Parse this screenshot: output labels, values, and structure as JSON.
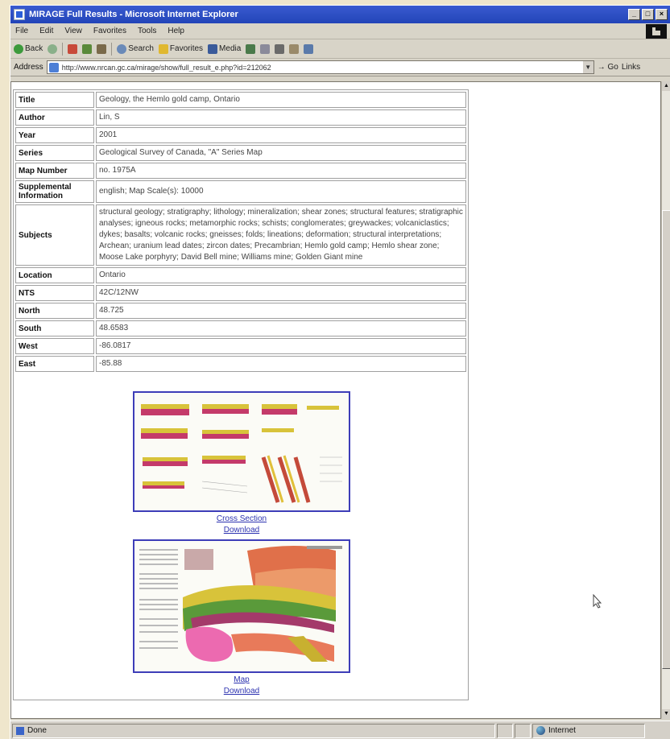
{
  "window": {
    "title": "MIRAGE Full Results - Microsoft Internet Explorer"
  },
  "menu": [
    "File",
    "Edit",
    "View",
    "Favorites",
    "Tools",
    "Help"
  ],
  "toolbar": {
    "back": "Back",
    "search": "Search",
    "favorites": "Favorites",
    "media": "Media"
  },
  "address": {
    "label": "Address",
    "url": "http://www.nrcan.gc.ca/mirage/show/full_result_e.php?id=212062",
    "go": "Go",
    "links": "Links"
  },
  "record": [
    {
      "label": "Title",
      "value": "Geology, the Hemlo gold camp, Ontario"
    },
    {
      "label": "Author",
      "value": "Lin, S"
    },
    {
      "label": "Year",
      "value": "2001"
    },
    {
      "label": "Series",
      "value": "Geological Survey of Canada, \"A\" Series Map"
    },
    {
      "label": "Map Number",
      "value": "no. 1975A"
    },
    {
      "label": "Supplemental Information",
      "value": "english; Map Scale(s): 10000"
    },
    {
      "label": "Subjects",
      "value": "structural geology; stratigraphy; lithology; mineralization; shear zones; structural features; stratigraphic analyses; igneous rocks; metamorphic rocks; schists; conglomerates; greywackes; volcaniclastics; dykes; basalts; volcanic rocks; gneisses; folds; lineations; deformation; structural interpretations; Archean; uranium lead dates; zircon dates; Precambrian; Hemlo gold camp; Hemlo shear zone; Moose Lake porphyry; David Bell mine; Williams mine; Golden Giant mine"
    },
    {
      "label": "Location",
      "value": "Ontario"
    },
    {
      "label": "NTS",
      "value": "42C/12NW"
    },
    {
      "label": "North",
      "value": "48.725"
    },
    {
      "label": "South",
      "value": "48.6583"
    },
    {
      "label": "West",
      "value": "-86.0817"
    },
    {
      "label": "East",
      "value": "-85.88"
    }
  ],
  "figures": [
    {
      "caption": "Cross Section",
      "download": "Download"
    },
    {
      "caption": "Map",
      "download": "Download"
    }
  ],
  "status": {
    "text": "Done",
    "zone": "Internet"
  }
}
